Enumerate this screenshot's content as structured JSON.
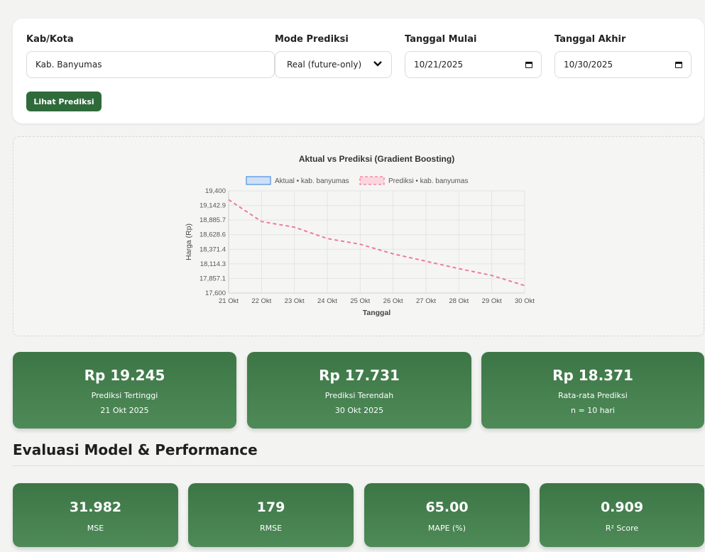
{
  "filters": {
    "kab_label": "Kab/Kota",
    "kab_value": "Kab. Banyumas",
    "mode_label": "Mode Prediksi",
    "mode_value": "Real (future-only)",
    "start_label": "Tanggal Mulai",
    "start_value": "10/21/2025",
    "end_label": "Tanggal Akhir",
    "end_value": "10/30/2025",
    "button_label": "Lihat Prediksi"
  },
  "chart_data": {
    "type": "line",
    "title": "Aktual vs Prediksi (Gradient Boosting)",
    "xlabel": "Tanggal",
    "ylabel": "Harga (Rp)",
    "categories": [
      "21 Okt",
      "22 Okt",
      "23 Okt",
      "24 Okt",
      "25 Okt",
      "26 Okt",
      "27 Okt",
      "28 Okt",
      "29 Okt",
      "30 Okt"
    ],
    "yticks": [
      "19,400",
      "19,142.9",
      "18,885.7",
      "18,628.6",
      "18,371.4",
      "18,114.3",
      "17,857.1",
      "17,600"
    ],
    "ylim": [
      17600,
      19400
    ],
    "grid": true,
    "legend_position": "top",
    "series": [
      {
        "name": "Aktual • kab. banyumas",
        "values": [],
        "color": "#4a8fe0",
        "fill": "#cfe0f6"
      },
      {
        "name": "Prediksi • kab. banyumas",
        "values": [
          19245,
          18860,
          18760,
          18560,
          18460,
          18290,
          18160,
          18030,
          17910,
          17731
        ],
        "color": "#f07a9a",
        "fill": "#fbd6df"
      }
    ]
  },
  "stats": [
    {
      "value": "Rp 19.245",
      "label": "Prediksi Tertinggi",
      "sub": "21 Okt 2025"
    },
    {
      "value": "Rp 17.731",
      "label": "Prediksi Terendah",
      "sub": "30 Okt 2025"
    },
    {
      "value": "Rp 18.371",
      "label": "Rata-rata Prediksi",
      "sub": "n = 10 hari"
    }
  ],
  "section_title": "Evaluasi Model & Performance",
  "metrics": [
    {
      "value": "31.982",
      "label": "MSE"
    },
    {
      "value": "179",
      "label": "RMSE"
    },
    {
      "value": "65.00",
      "label": "MAPE (%)"
    },
    {
      "value": "0.909",
      "label": "R² Score"
    }
  ],
  "colors": {
    "accent": "#2f6a3b",
    "card_top": "#3d7646",
    "card_bottom": "#4e8a58"
  }
}
